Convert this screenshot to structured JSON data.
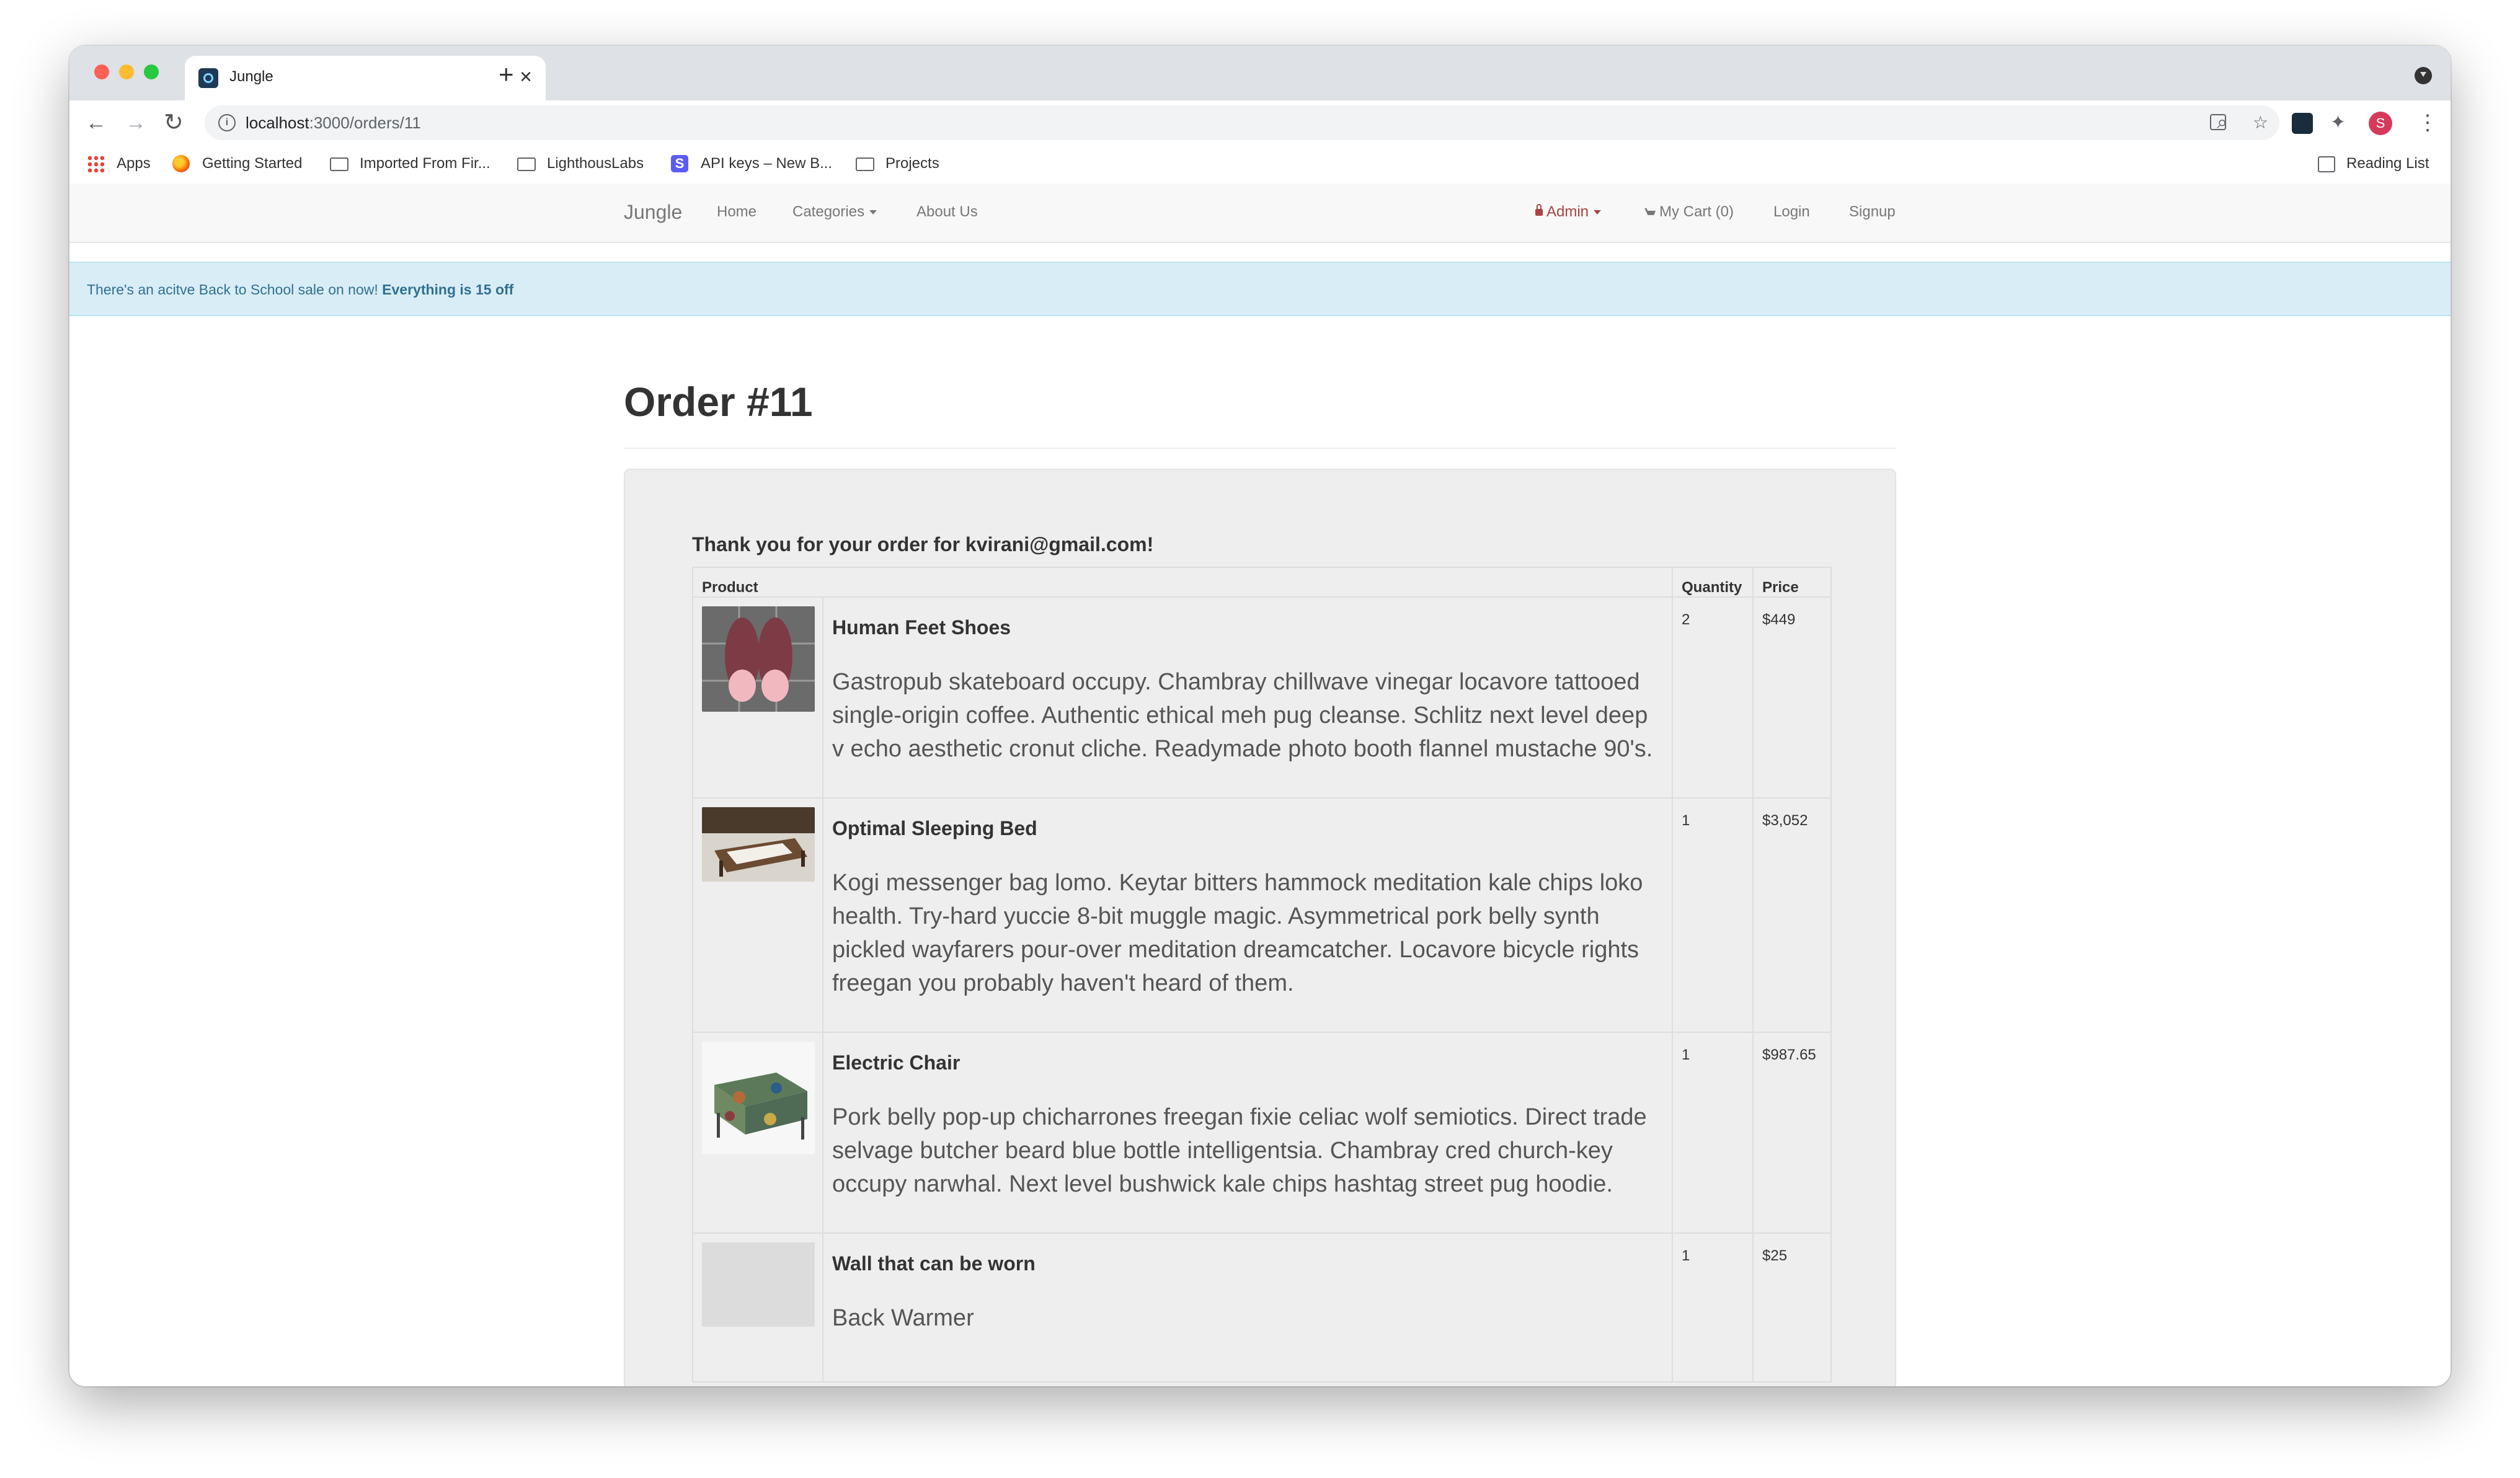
{
  "browser": {
    "tab_title": "Jungle",
    "url_host": "localhost",
    "url_path": ":3000/orders/11",
    "bookmarks": [
      "Apps",
      "Getting Started",
      "Imported From Fir...",
      "LighthousLabs",
      "API keys – New B...",
      "Projects"
    ],
    "reading_list": "Reading List",
    "profile_initial": "S"
  },
  "navbar": {
    "brand": "Jungle",
    "home": "Home",
    "categories": "Categories",
    "about": "About Us",
    "admin": "Admin",
    "cart": "My Cart (0)",
    "login": "Login",
    "signup": "Signup"
  },
  "alert": {
    "text": "There's an acitve Back to School sale on now!",
    "emphasis": "Everything is 15 off"
  },
  "order": {
    "title": "Order #11",
    "thank_you": "Thank you for your order for kvirani@gmail.com!",
    "columns": {
      "product": "Product",
      "quantity": "Quantity",
      "price": "Price"
    },
    "items": [
      {
        "name": "Human Feet Shoes",
        "description": "Gastropub skateboard occupy. Chambray chillwave vinegar locavore tattooed single-origin coffee. Authentic ethical meh pug cleanse. Schlitz next level deep v echo aesthetic cronut cliche. Readymade photo booth flannel mustache 90's.",
        "quantity": "2",
        "price": "$449"
      },
      {
        "name": "Optimal Sleeping Bed",
        "description": "Kogi messenger bag lomo. Keytar bitters hammock meditation kale chips loko health. Try-hard yuccie 8-bit muggle magic. Asymmetrical pork belly synth pickled wayfarers pour-over meditation dreamcatcher. Locavore bicycle rights freegan you probably haven't heard of them.",
        "quantity": "1",
        "price": "$3,052"
      },
      {
        "name": "Electric Chair",
        "description": "Pork belly pop-up chicharrones freegan fixie celiac wolf semiotics. Direct trade selvage butcher beard blue bottle intelligentsia. Chambray cred church-key occupy narwhal. Next level bushwick kale chips hashtag street pug hoodie.",
        "quantity": "1",
        "price": "$987.65"
      },
      {
        "name": "Wall that can be worn",
        "description": "Back Warmer",
        "quantity": "1",
        "price": "$25"
      }
    ]
  },
  "colors": {
    "alert_bg": "#d9edf7",
    "alert_text": "#31708f",
    "admin": "#a94442",
    "well_bg": "#eeeeee",
    "navbar_bg": "#f8f8f8"
  },
  "icons": [
    "tab-favicon-icon",
    "close-icon",
    "plus-icon",
    "back-arrow-icon",
    "forward-arrow-icon",
    "reload-icon",
    "info-icon",
    "zoom-icon",
    "card-icon",
    "star-icon",
    "extension-icon",
    "puzzle-icon",
    "menu-dots-icon",
    "apps-grid-icon",
    "folder-icon",
    "reading-list-icon",
    "lock-icon",
    "cart-icon"
  ]
}
